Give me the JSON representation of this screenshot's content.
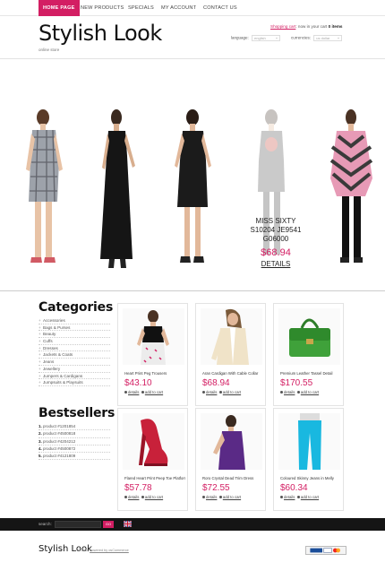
{
  "nav": {
    "items": [
      "Home Page",
      "New Products",
      "Specials",
      "My Account",
      "Contact Us"
    ]
  },
  "header": {
    "logo": "Stylish Look",
    "tagline": "online store",
    "cart_link": "Shopping cart",
    "cart_text": ": now in your cart",
    "cart_count": "0 items",
    "language_label": "language:",
    "language_value": "english",
    "currencies_label": "currencies:",
    "currencies_value": "us dollar"
  },
  "slider": {
    "product_name": "MISS SIXTY S10204 JE9541 G06000",
    "price": "$68.94",
    "details_label": "DETAILS"
  },
  "sidebar": {
    "categories_heading": "Categories",
    "categories": [
      "Accessories",
      "Bags & Purses",
      "Beauty",
      "Cuffs",
      "Dresses",
      "Jackets & Coats",
      "Jeans",
      "Jewellery",
      "Jumpers & Cardigans",
      "Jumpsuits & Playsuits"
    ],
    "bestsellers_heading": "Bestsellers",
    "bestsellers": [
      {
        "num": "1.",
        "name": "product #1201854"
      },
      {
        "num": "2.",
        "name": "product #4500818"
      },
      {
        "num": "3.",
        "name": "product #4204212"
      },
      {
        "num": "4.",
        "name": "product #4500872"
      },
      {
        "num": "5.",
        "name": "product #4121809"
      }
    ]
  },
  "products": [
    {
      "name": "Heart Print Peg Trousers",
      "price": "$43.10",
      "details": "details",
      "cart": "add to cart"
    },
    {
      "name": "Aran Cardigan With Cable Collar",
      "price": "$68.94",
      "details": "details",
      "cart": "add to cart"
    },
    {
      "name": "Premium Leather Tassel Detail",
      "price": "$170.55",
      "details": "details",
      "cart": "add to cart"
    },
    {
      "name": "Flared Heart Print Peep Toe Platform",
      "price": "$57.78",
      "details": "details",
      "cart": "add to cart"
    },
    {
      "name": "Roro Crystal Dead Trim Dress",
      "price": "$72.55",
      "details": "details",
      "cart": "add to cart"
    },
    {
      "name": "Coloured Skinny Jeans in Melly",
      "price": "$60.34",
      "details": "details",
      "cart": "add to cart"
    }
  ],
  "footer": {
    "search_label": "search:",
    "search_button": "GO",
    "logo": "Stylish Look",
    "copyright": "© 2011",
    "powered": "Powered by osCommerce",
    "payment": "PayPal VISA"
  },
  "colors": {
    "accent": "#d31e63",
    "footer_bg": "#151515"
  }
}
